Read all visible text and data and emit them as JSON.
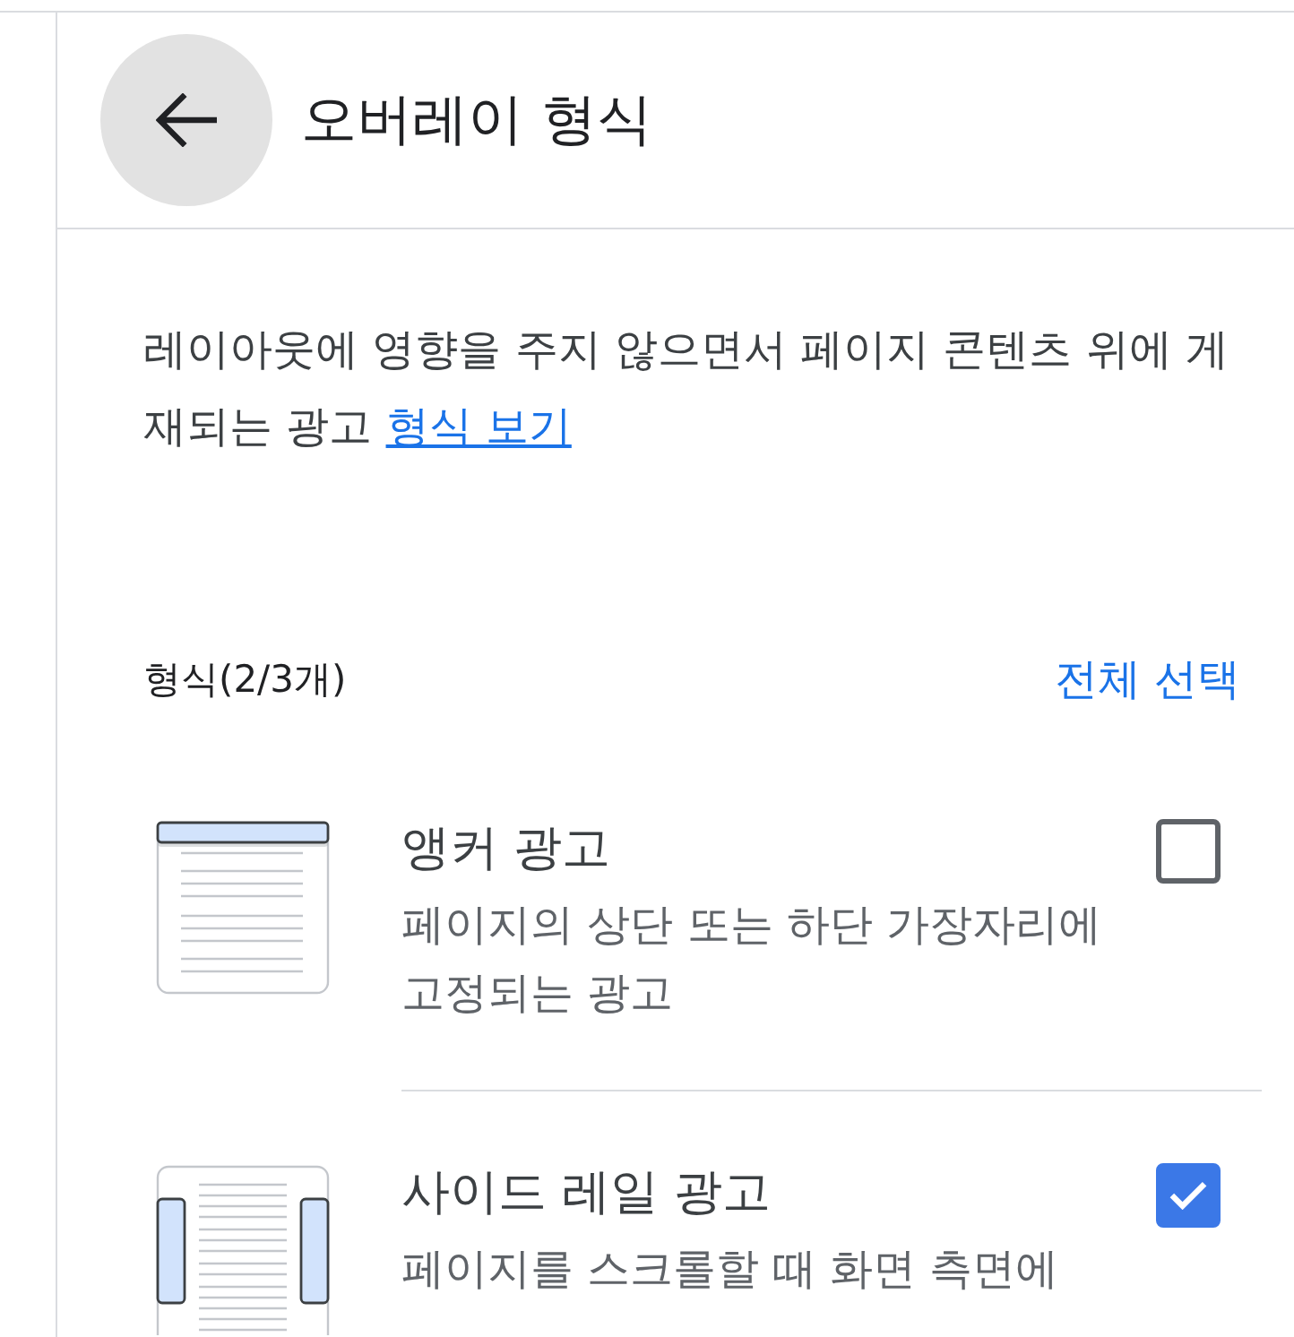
{
  "header": {
    "title": "오버레이 형식"
  },
  "description": {
    "text": "레이아웃에 영향을 주지 않으면서 페이지 콘텐츠 위에 게재되는 광고",
    "link": "형식 보기"
  },
  "formats": {
    "count_label": "형식(2/3개)",
    "select_all": "전체 선택",
    "items": [
      {
        "kind": "top_bar",
        "title": "앵커 광고",
        "description": "페이지의 상단 또는 하단 가장자리에 고정되는 광고",
        "checked": false
      },
      {
        "kind": "side_rails",
        "title": "사이드 레일 광고",
        "description": "페이지를 스크롤할 때 화면 측면에",
        "checked": true
      }
    ]
  }
}
